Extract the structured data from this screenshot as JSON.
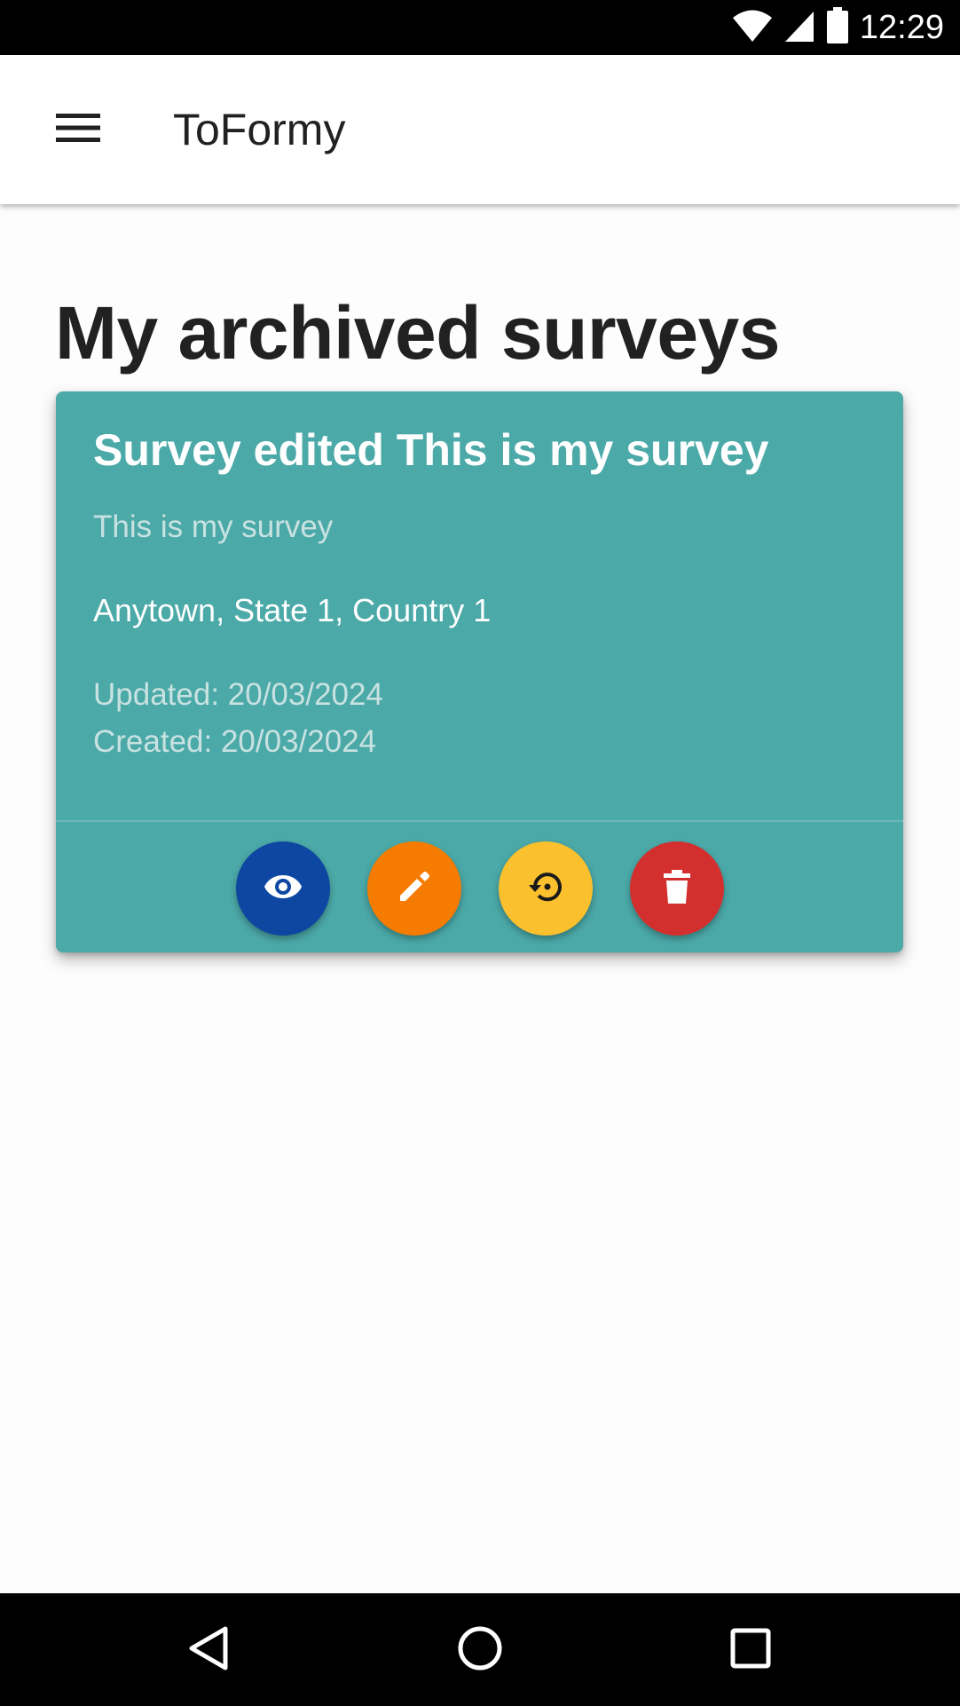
{
  "status_bar": {
    "time": "12:29",
    "icons": [
      "wifi-icon",
      "cell-signal-icon",
      "battery-icon"
    ]
  },
  "app_bar": {
    "title": "ToFormy",
    "menu_icon": "hamburger-menu-icon"
  },
  "page": {
    "title": "My archived surveys"
  },
  "survey_card": {
    "title": "Survey edited This is my survey",
    "description": "This is my survey",
    "location": "Anytown, State 1, Country 1",
    "updated": "Updated: 20/03/2024",
    "created": "Created: 20/03/2024",
    "background_color": "#4ba9a8",
    "actions": [
      {
        "name": "view",
        "icon": "eye-icon",
        "color": "#0d47a1"
      },
      {
        "name": "edit",
        "icon": "pencil-icon",
        "color": "#f57c00"
      },
      {
        "name": "restore",
        "icon": "restore-icon",
        "color": "#fbc02d"
      },
      {
        "name": "delete",
        "icon": "trash-icon",
        "color": "#d32f2f"
      }
    ]
  },
  "nav_bar": {
    "buttons": [
      "back-icon",
      "home-icon",
      "recents-icon"
    ]
  }
}
